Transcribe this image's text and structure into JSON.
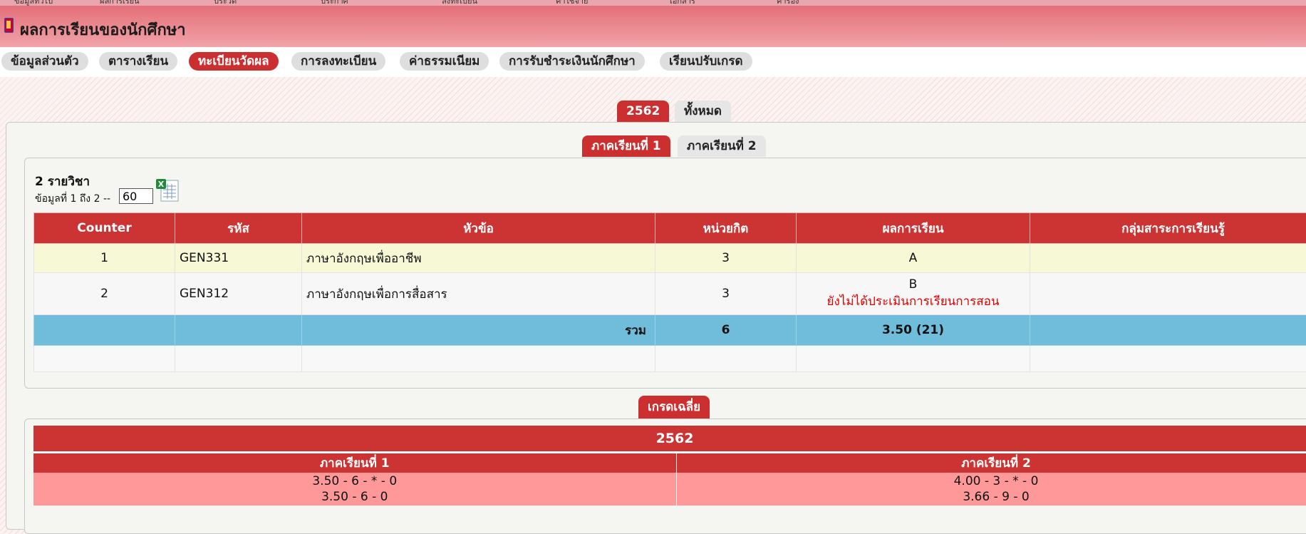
{
  "topnav_partial": [
    "ข้อมูลทั่วไป",
    "ผลการเรียน",
    "ประวัติ",
    "ประกาศ",
    "ลงทะเบียน",
    "ค่าใช้จ่าย",
    "เอกสาร",
    "คำร้อง"
  ],
  "page_title": "ผลการเรียนของนักศึกษา",
  "nav_tabs": [
    "ข้อมูลส่วนตัว",
    "ตารางเรียน",
    "ทะเบียนวัดผล",
    "การลงทะเบียน",
    "ค่าธรรมเนียม",
    "การรับชำระเงินนักศึกษา",
    "เรียนปรับเกรด"
  ],
  "nav_active": "ทะเบียนวัดผล",
  "year_tabs": [
    "2562",
    "ทั้งหมด"
  ],
  "semester_tabs": [
    "ภาคเรียนที่ 1",
    "ภาคเรียนที่ 2"
  ],
  "summary": {
    "count_text": "2 รายวิชา",
    "range_text": "ข้อมูลที่ 1 ถึง 2 --",
    "page_size": "60"
  },
  "table": {
    "headers": [
      "Counter",
      "รหัส",
      "หัวข้อ",
      "หน่วยกิต",
      "ผลการเรียน",
      "กลุ่มสาระการเรียนรู้"
    ],
    "rows": [
      {
        "counter": "1",
        "code": "GEN331",
        "title": "ภาษาอังกฤษเพื่ออาชีพ",
        "credits": "3",
        "grade": "A",
        "note": "",
        "group": ""
      },
      {
        "counter": "2",
        "code": "GEN312",
        "title": "ภาษาอังกฤษเพื่อการสื่อสาร",
        "credits": "3",
        "grade": "B",
        "note": "ยังไม่ได้ประเมินการเรียนการสอน",
        "group": ""
      }
    ],
    "total": {
      "label": "รวม",
      "credits": "6",
      "gpa": "3.50 (21)"
    }
  },
  "gpa_section": {
    "tab_label": "เกรดเฉลี่ย",
    "year": "2562",
    "semesters": [
      {
        "label": "ภาคเรียนที่ 1",
        "line1": "3.50 - 6 - * - 0",
        "line2": "3.50 - 6 - 0"
      },
      {
        "label": "ภาคเรียนที่ 2",
        "line1": "4.00 - 3 - * - 0",
        "line2": "3.66 - 9 - 0"
      }
    ]
  },
  "colors": {
    "accent": "#cc3333",
    "total_row": "#70bcdb",
    "gpa_values": "#ff9999",
    "pending_note": "#e30000"
  }
}
